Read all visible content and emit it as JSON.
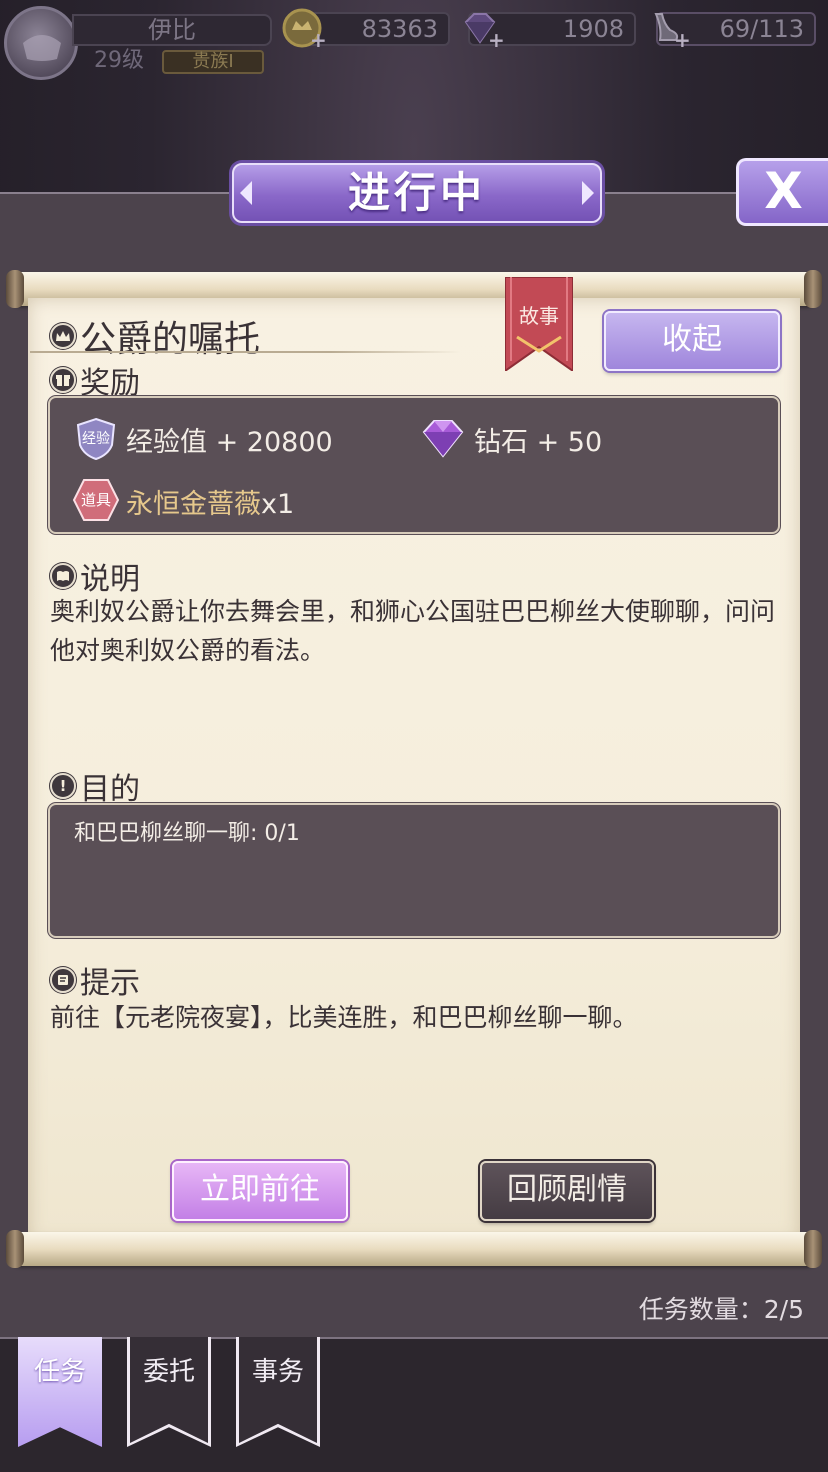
{
  "player": {
    "name": "伊比",
    "level": "29级",
    "rank": "贵族I"
  },
  "resources": {
    "gold": "83363",
    "diamonds": "1908",
    "stamina": "69/113"
  },
  "header": {
    "title": "进行中",
    "close_label": "X"
  },
  "task": {
    "title": "公爵的嘱托",
    "type_ribbon": "故事",
    "collapse_label": "收起"
  },
  "rewards": {
    "heading": "奖励",
    "exp_badge": "经验",
    "exp": "经验值 + 20800",
    "diamond": "钻石 + 50",
    "item_badge": "道具",
    "item_name": "永恒金蔷薇",
    "item_count": "x1"
  },
  "description": {
    "heading": "说明",
    "text": "奥利奴公爵让你去舞会里，和狮心公国驻巴巴柳丝大使聊聊，问问他对奥利奴公爵的看法。"
  },
  "objective": {
    "heading": "目的",
    "text": "和巴巴柳丝聊一聊: 0/1"
  },
  "hint": {
    "heading": "提示",
    "text": "前往【元老院夜宴】，比美连胜，和巴巴柳丝聊一聊。"
  },
  "actions": {
    "go": "立即前往",
    "review": "回顾剧情"
  },
  "task_count": "任务数量：2/5",
  "tabs": [
    {
      "label": "任务",
      "active": true
    },
    {
      "label": "委托",
      "active": false
    },
    {
      "label": "事务",
      "active": false
    }
  ],
  "colors": {
    "accent_purple": "#8a68c9",
    "paper": "#f5eedc",
    "dark_box": "#5a4f56",
    "item_gold": "#e6c88c"
  },
  "icons": {
    "gold": "gold-coin-icon",
    "diamond": "purple-diamond-icon",
    "stamina": "shoe-icon",
    "crown": "crown-icon",
    "reward": "gift-icon",
    "description": "book-icon",
    "objective": "exclamation-icon",
    "hint": "note-icon"
  }
}
